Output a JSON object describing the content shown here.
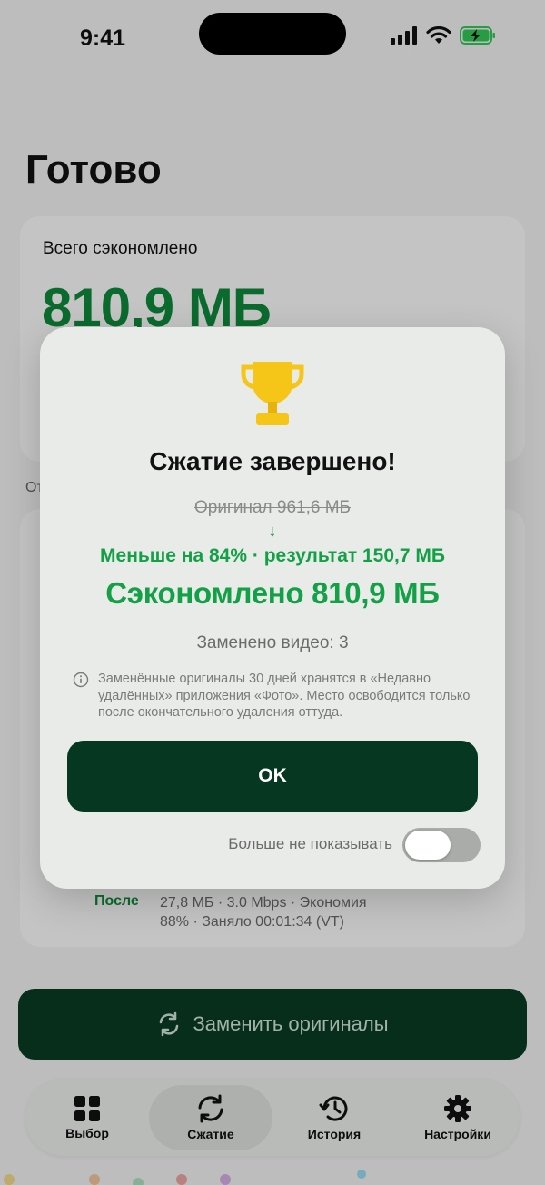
{
  "status_bar": {
    "time": "9:41"
  },
  "screen": {
    "title": "Готово",
    "total_label": "Всего сэкономлено",
    "total_value": "810,9 МБ",
    "section_label_partial": "От",
    "after_label": "После",
    "after_detail": "27,8 МБ · 3.0 Mbps · Экономия 88% · Заняло 00:01:34 (VT)",
    "replace_button": "Заменить оригиналы"
  },
  "tabs": [
    {
      "label": "Выбор",
      "icon": "grid-icon"
    },
    {
      "label": "Сжатие",
      "icon": "refresh-icon",
      "active": true
    },
    {
      "label": "История",
      "icon": "history-icon"
    },
    {
      "label": "Настройки",
      "icon": "gear-icon"
    }
  ],
  "modal": {
    "icon": "trophy-icon",
    "title": "Сжатие завершено!",
    "original": "Оригинал 961,6 МБ",
    "arrow": "↓",
    "less": "Меньше на 84% · результат 150,7 МБ",
    "saved": "Сэкономлено 810,9 МБ",
    "replaced": "Заменено видео: 3",
    "note": "Заменённые оригиналы 30 дней хранятся в «Недавно удалённых» приложения «Фото». Место освободится только после окончательного удаления оттуда.",
    "ok_button": "OK",
    "dont_show_label": "Больше не показывать",
    "dont_show_enabled": false
  },
  "colors": {
    "accent_green": "#14a047",
    "dark_button": "#063721",
    "battery_green": "#34c759"
  }
}
